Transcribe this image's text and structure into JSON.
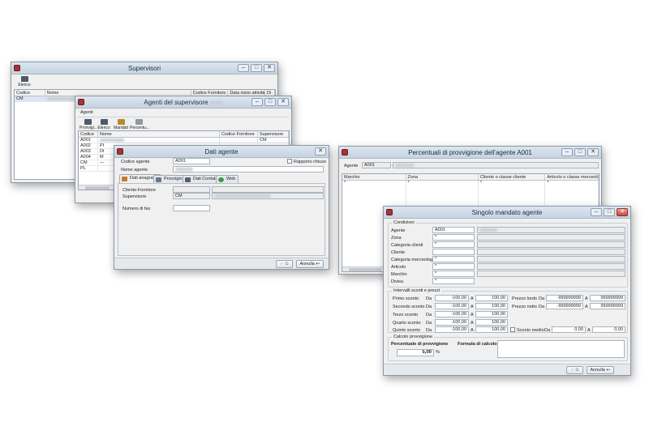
{
  "sup": {
    "title": "Supervisori",
    "toolbar_elenco": "Elenco",
    "columns": [
      "Codice",
      "Nome",
      "Codice Fornitore",
      "Data inizio attività",
      "Di"
    ],
    "rows": [
      {
        "code": "CM"
      }
    ]
  },
  "agsup": {
    "title_prefix": "Agenti del supervisore",
    "toolbar_group": "Agenti",
    "toolbar": [
      "Provvigi...",
      "Elenco",
      "Mandati",
      "Percentu..."
    ],
    "columns": [
      "Codice",
      "Nome",
      "Codice Fornitore",
      "Supervisore"
    ],
    "rows": [
      {
        "code": "A001",
        "name": "",
        "sup": "CM"
      },
      {
        "code": "A002",
        "name": "PI",
        "sup": ""
      },
      {
        "code": "A003",
        "name": "DI",
        "sup": ""
      },
      {
        "code": "A004",
        "name": "M",
        "sup": ""
      },
      {
        "code": "CM",
        "name": "—",
        "sup": ""
      },
      {
        "code": "PL",
        "name": "",
        "sup": ""
      }
    ]
  },
  "dati": {
    "title": "Dati agente",
    "codice_label": "Codice agente",
    "codice_value": "A001",
    "nome_label": "Nome agente",
    "rapporto_label": "Rapporto chiuso",
    "tabs": [
      "Dati anagrafici",
      "Provvigioni",
      "Dati Contabili",
      "Web"
    ],
    "cliente_label": "Cliente-Fornitore",
    "supervisore_label": "Supervisore",
    "supervisore_code": "CM",
    "fax_label": "Numero di fax",
    "annulla": "Annulla"
  },
  "perc": {
    "title": "Percentuali di provvigione dell'agente A001",
    "agente_label": "Agente",
    "agente_value": "A001",
    "columns": [
      "Marchio",
      "Zona",
      "Cliente o classe cliente",
      "Articolo o classe merceologica"
    ],
    "row_marker": "*"
  },
  "sing": {
    "title": "Singolo mandato agente",
    "condizioni_title": "Condizioni",
    "cond_labels": [
      "Agente",
      "Zona",
      "Categoria clienti",
      "Cliente",
      "Categoria merceologica",
      "Articolo",
      "Marchio",
      "Divisa"
    ],
    "cond_values": [
      "A001",
      "*",
      "*",
      "",
      "*",
      "*",
      "*",
      "*"
    ],
    "intervalli_title": "Intervalli sconti e prezzi",
    "sconti": [
      {
        "label": "Primo sconto",
        "da": "-100,00",
        "a": "100,00"
      },
      {
        "label": "Secondo sconto",
        "da": "-100,00",
        "a": "100,00"
      },
      {
        "label": "Terzo sconto",
        "da": "-100,00",
        "a": "100,00"
      },
      {
        "label": "Quarto sconto",
        "da": "-100,00",
        "a": "100,00"
      },
      {
        "label": "Quinto sconto",
        "da": "-100,00",
        "a": "100,00"
      }
    ],
    "da_label": "Da",
    "a_label": "A",
    "prezzi": [
      {
        "label": "Prezzo lordo",
        "da": "-999999999",
        "a": "999999999"
      },
      {
        "label": "Prezzo netto",
        "da": "-999999999",
        "a": "999999999"
      }
    ],
    "sconto_medio_label": "Sconto medio",
    "sconto_medio_da": "0,00",
    "sconto_medio_a": "0,00",
    "calcolo_title": "Calcolo provvigione",
    "perc_label": "Percentuale di provvigione",
    "perc_value": "5,00",
    "perc_unit": "%",
    "formula_label": "Formula di calcolo",
    "annulla": "Annulla"
  }
}
